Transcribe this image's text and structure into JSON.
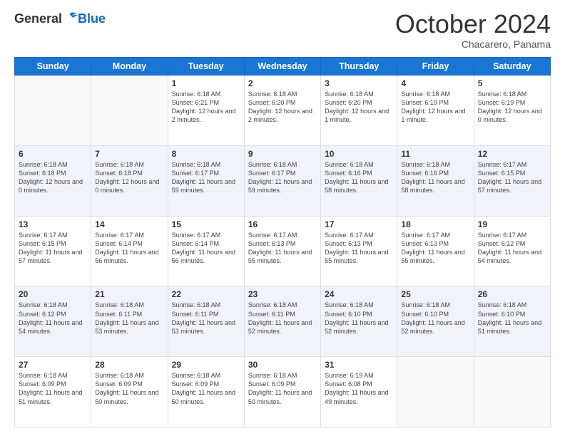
{
  "logo": {
    "general": "General",
    "blue": "Blue"
  },
  "header": {
    "month": "October 2024",
    "location": "Chacarero, Panama"
  },
  "weekdays": [
    "Sunday",
    "Monday",
    "Tuesday",
    "Wednesday",
    "Thursday",
    "Friday",
    "Saturday"
  ],
  "weeks": [
    [
      {
        "day": "",
        "info": ""
      },
      {
        "day": "",
        "info": ""
      },
      {
        "day": "1",
        "info": "Sunrise: 6:18 AM\nSunset: 6:21 PM\nDaylight: 12 hours and 2 minutes."
      },
      {
        "day": "2",
        "info": "Sunrise: 6:18 AM\nSunset: 6:20 PM\nDaylight: 12 hours and 2 minutes."
      },
      {
        "day": "3",
        "info": "Sunrise: 6:18 AM\nSunset: 6:20 PM\nDaylight: 12 hours and 1 minute."
      },
      {
        "day": "4",
        "info": "Sunrise: 6:18 AM\nSunset: 6:19 PM\nDaylight: 12 hours and 1 minute."
      },
      {
        "day": "5",
        "info": "Sunrise: 6:18 AM\nSunset: 6:19 PM\nDaylight: 12 hours and 0 minutes."
      }
    ],
    [
      {
        "day": "6",
        "info": "Sunrise: 6:18 AM\nSunset: 6:18 PM\nDaylight: 12 hours and 0 minutes."
      },
      {
        "day": "7",
        "info": "Sunrise: 6:18 AM\nSunset: 6:18 PM\nDaylight: 12 hours and 0 minutes."
      },
      {
        "day": "8",
        "info": "Sunrise: 6:18 AM\nSunset: 6:17 PM\nDaylight: 11 hours and 59 minutes."
      },
      {
        "day": "9",
        "info": "Sunrise: 6:18 AM\nSunset: 6:17 PM\nDaylight: 11 hours and 59 minutes."
      },
      {
        "day": "10",
        "info": "Sunrise: 6:18 AM\nSunset: 6:16 PM\nDaylight: 11 hours and 58 minutes."
      },
      {
        "day": "11",
        "info": "Sunrise: 6:18 AM\nSunset: 6:16 PM\nDaylight: 11 hours and 58 minutes."
      },
      {
        "day": "12",
        "info": "Sunrise: 6:17 AM\nSunset: 6:15 PM\nDaylight: 11 hours and 57 minutes."
      }
    ],
    [
      {
        "day": "13",
        "info": "Sunrise: 6:17 AM\nSunset: 6:15 PM\nDaylight: 11 hours and 57 minutes."
      },
      {
        "day": "14",
        "info": "Sunrise: 6:17 AM\nSunset: 6:14 PM\nDaylight: 11 hours and 56 minutes."
      },
      {
        "day": "15",
        "info": "Sunrise: 6:17 AM\nSunset: 6:14 PM\nDaylight: 11 hours and 56 minutes."
      },
      {
        "day": "16",
        "info": "Sunrise: 6:17 AM\nSunset: 6:13 PM\nDaylight: 11 hours and 55 minutes."
      },
      {
        "day": "17",
        "info": "Sunrise: 6:17 AM\nSunset: 6:13 PM\nDaylight: 11 hours and 55 minutes."
      },
      {
        "day": "18",
        "info": "Sunrise: 6:17 AM\nSunset: 6:13 PM\nDaylight: 11 hours and 55 minutes."
      },
      {
        "day": "19",
        "info": "Sunrise: 6:17 AM\nSunset: 6:12 PM\nDaylight: 11 hours and 54 minutes."
      }
    ],
    [
      {
        "day": "20",
        "info": "Sunrise: 6:18 AM\nSunset: 6:12 PM\nDaylight: 11 hours and 54 minutes."
      },
      {
        "day": "21",
        "info": "Sunrise: 6:18 AM\nSunset: 6:11 PM\nDaylight: 11 hours and 53 minutes."
      },
      {
        "day": "22",
        "info": "Sunrise: 6:18 AM\nSunset: 6:11 PM\nDaylight: 11 hours and 53 minutes."
      },
      {
        "day": "23",
        "info": "Sunrise: 6:18 AM\nSunset: 6:11 PM\nDaylight: 11 hours and 52 minutes."
      },
      {
        "day": "24",
        "info": "Sunrise: 6:18 AM\nSunset: 6:10 PM\nDaylight: 11 hours and 52 minutes."
      },
      {
        "day": "25",
        "info": "Sunrise: 6:18 AM\nSunset: 6:10 PM\nDaylight: 11 hours and 52 minutes."
      },
      {
        "day": "26",
        "info": "Sunrise: 6:18 AM\nSunset: 6:10 PM\nDaylight: 11 hours and 51 minutes."
      }
    ],
    [
      {
        "day": "27",
        "info": "Sunrise: 6:18 AM\nSunset: 6:09 PM\nDaylight: 11 hours and 51 minutes."
      },
      {
        "day": "28",
        "info": "Sunrise: 6:18 AM\nSunset: 6:09 PM\nDaylight: 11 hours and 50 minutes."
      },
      {
        "day": "29",
        "info": "Sunrise: 6:18 AM\nSunset: 6:09 PM\nDaylight: 11 hours and 50 minutes."
      },
      {
        "day": "30",
        "info": "Sunrise: 6:18 AM\nSunset: 6:09 PM\nDaylight: 11 hours and 50 minutes."
      },
      {
        "day": "31",
        "info": "Sunrise: 6:19 AM\nSunset: 6:08 PM\nDaylight: 11 hours and 49 minutes."
      },
      {
        "day": "",
        "info": ""
      },
      {
        "day": "",
        "info": ""
      }
    ]
  ]
}
